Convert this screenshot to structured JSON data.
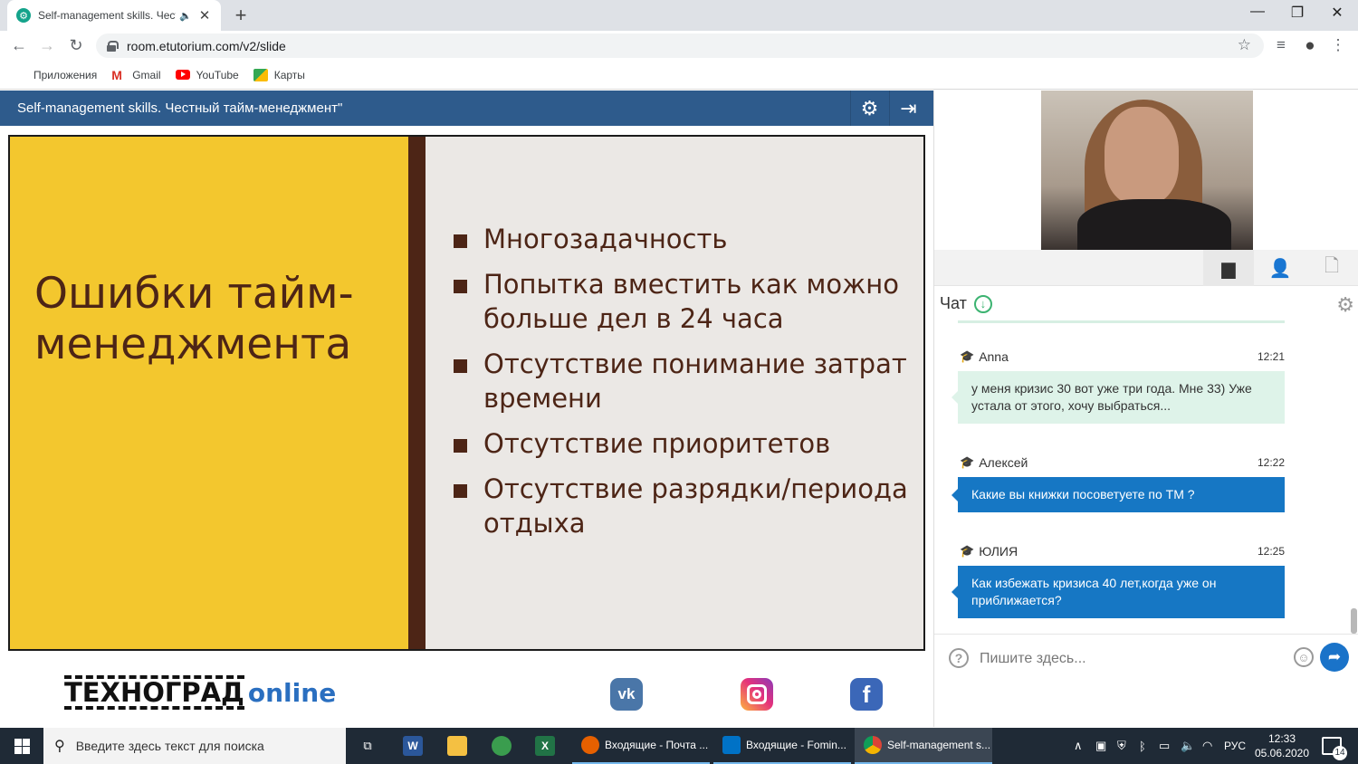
{
  "browser": {
    "tab_title": "Self-management skills. Чест",
    "tab_favicon": "etutorium-favicon",
    "new_tab_symbol": "+",
    "window_controls": [
      "—",
      "❐",
      "✕"
    ],
    "url": "room.etutorium.com/v2/slide",
    "bookmarks": [
      {
        "label": "Приложения",
        "icon": "apps-icon"
      },
      {
        "label": "Gmail",
        "icon": "gmail-icon"
      },
      {
        "label": "YouTube",
        "icon": "youtube-icon"
      },
      {
        "label": "Карты",
        "icon": "maps-icon"
      }
    ]
  },
  "app": {
    "header_title": "Self-management skills. Честный тайм-менеджмент\"",
    "settings_icon": "gear-icon",
    "exit_icon": "exit-icon"
  },
  "slide": {
    "title": "Ошибки тайм-менеджмента",
    "bullets": [
      "Многозадачность",
      "Попытка вместить как можно больше дел в 24 часа",
      "Отсутствие понимание затрат времени",
      "Отсутствие приоритетов",
      "Отсутствие разрядки/периода отдыха"
    ],
    "colors": {
      "yellow": "#f3c72e",
      "brown": "#4d2516",
      "background": "#ebe8e5"
    }
  },
  "footer": {
    "logo_main": "ТЕХНОГРАД",
    "logo_sub": "online",
    "social": [
      "vk-icon",
      "instagram-icon",
      "facebook-icon"
    ]
  },
  "chat": {
    "title": "Чат",
    "messages": [
      {
        "author": "Anna",
        "time": "12:21",
        "text": "у меня кризис 30 вот уже три года. Мне 33) Уже устала от этого, хочу выбраться...",
        "style": "light"
      },
      {
        "author": "Алексей",
        "time": "12:22",
        "text": "Какие вы книжки посоветуете по ТМ ?",
        "style": "blue"
      },
      {
        "author": "ЮЛИЯ",
        "time": "12:25",
        "text": "Как избежать кризиса 40 лет,когда уже он приближается?",
        "style": "blue"
      }
    ],
    "input_placeholder": "Пишите здесь..."
  },
  "taskbar": {
    "search_placeholder": "Введите здесь текст для поиска",
    "windows": [
      {
        "label": "Входящие - Почта ...",
        "icon": "firefox-icon"
      },
      {
        "label": "Входящие - Fomin...",
        "icon": "outlook-icon"
      },
      {
        "label": "Self-management s...",
        "icon": "chrome-icon"
      }
    ],
    "language": "РУС",
    "time": "12:33",
    "date": "05.06.2020",
    "notifications": "14"
  }
}
